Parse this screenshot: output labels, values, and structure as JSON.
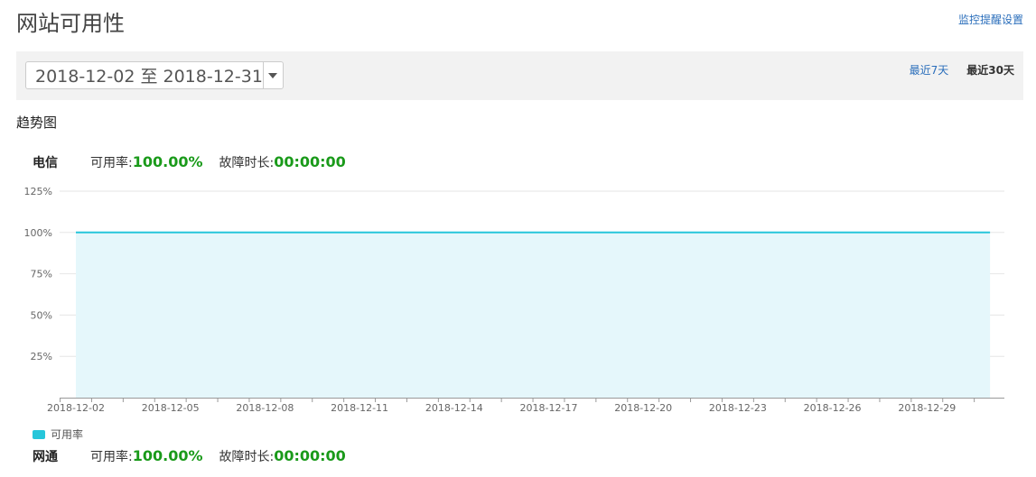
{
  "page": {
    "title": "网站可用性",
    "monitor_settings_link": "监控提醒设置"
  },
  "toolbar": {
    "date_range": "2018-12-02 至 2018-12-31",
    "range_7": "最近7天",
    "range_30": "最近30天"
  },
  "section_title": "趋势图",
  "carriers": [
    {
      "name": "电信",
      "availability_label": "可用率:",
      "availability": "100.00%",
      "downtime_label": "故障时长:",
      "downtime": "00:00:00"
    },
    {
      "name": "网通",
      "availability_label": "可用率:",
      "availability": "100.00%",
      "downtime_label": "故障时长:",
      "downtime": "00:00:00"
    }
  ],
  "chart_data": {
    "type": "area",
    "ytick_labels": [
      "125%",
      "100%",
      "75%",
      "50%",
      "25%"
    ],
    "ylim": [
      0,
      125
    ],
    "yticks": [
      125,
      100,
      75,
      50,
      25
    ],
    "x": [
      "2018-12-02",
      "2018-12-03",
      "2018-12-04",
      "2018-12-05",
      "2018-12-06",
      "2018-12-07",
      "2018-12-08",
      "2018-12-09",
      "2018-12-10",
      "2018-12-11",
      "2018-12-12",
      "2018-12-13",
      "2018-12-14",
      "2018-12-15",
      "2018-12-16",
      "2018-12-17",
      "2018-12-18",
      "2018-12-19",
      "2018-12-20",
      "2018-12-21",
      "2018-12-22",
      "2018-12-23",
      "2018-12-24",
      "2018-12-25",
      "2018-12-26",
      "2018-12-27",
      "2018-12-28",
      "2018-12-29",
      "2018-12-30",
      "2018-12-31"
    ],
    "xtick_labels": [
      "2018-12-02",
      "2018-12-05",
      "2018-12-08",
      "2018-12-11",
      "2018-12-14",
      "2018-12-17",
      "2018-12-20",
      "2018-12-23",
      "2018-12-26",
      "2018-12-29"
    ],
    "series": [
      {
        "name": "可用率",
        "color": "#26c6da",
        "fill": "#e5f7fb",
        "values": [
          100,
          100,
          100,
          100,
          100,
          100,
          100,
          100,
          100,
          100,
          100,
          100,
          100,
          100,
          100,
          100,
          100,
          100,
          100,
          100,
          100,
          100,
          100,
          100,
          100,
          100,
          100,
          100,
          100,
          100
        ]
      }
    ],
    "grid": true,
    "legend": "bottom-left"
  }
}
